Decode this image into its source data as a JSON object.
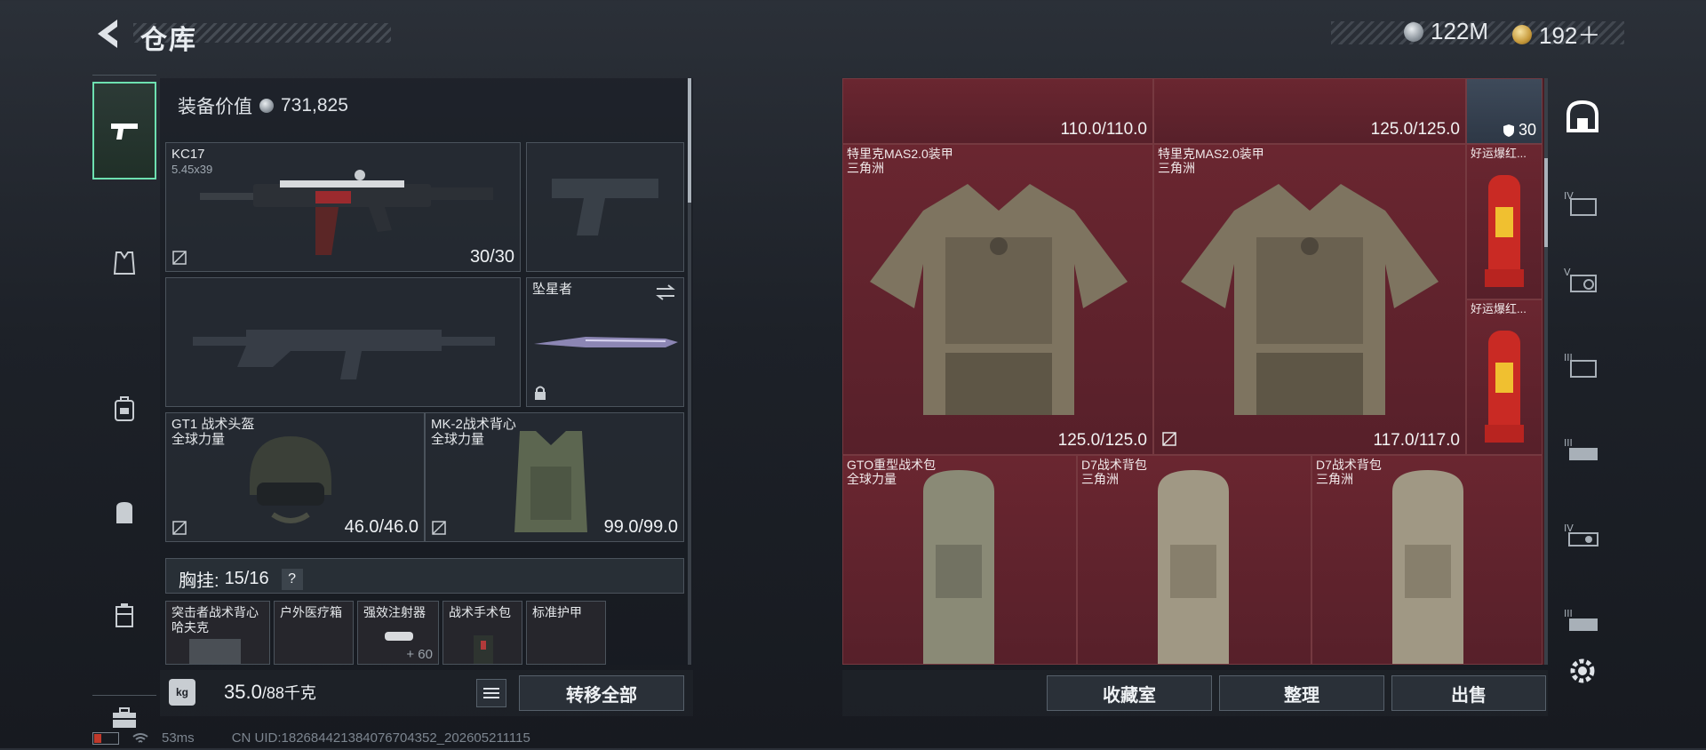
{
  "header": {
    "title": "仓库",
    "currency": [
      {
        "icon": "silver-coin-icon",
        "value": "122M"
      },
      {
        "icon": "gold-coin-icon",
        "value": "192＋"
      }
    ]
  },
  "left_sidebar": {
    "items": [
      {
        "icon": "pistol-icon",
        "active": true
      },
      {
        "icon": "vest-icon",
        "active": false
      },
      {
        "icon": "backpack-alt-icon",
        "active": false
      },
      {
        "icon": "backpack-icon",
        "active": false
      },
      {
        "icon": "case-icon",
        "active": false
      },
      {
        "icon": "briefcase-icon",
        "active": false
      }
    ]
  },
  "equipment": {
    "value_label": "装备价值",
    "value": "731,825",
    "primary_weapon": {
      "name": "KC17",
      "caliber": "5.45x39",
      "ammo": "30/30"
    },
    "melee": {
      "name": "坠星者"
    },
    "helmet": {
      "name": "GT1 战术头盔",
      "brand": "全球力量",
      "durability": "46.0/46.0"
    },
    "armor": {
      "name": "MK-2战术背心",
      "brand": "全球力量",
      "durability": "99.0/99.0"
    },
    "chest_rig": {
      "label": "胸挂:",
      "count": "15/16",
      "help": "?"
    },
    "rig_items": [
      {
        "name": "突击者战术背心 哈夫克"
      },
      {
        "name": "户外医疗箱"
      },
      {
        "name": "强效注射器",
        "count": "+ 60"
      },
      {
        "name": "战术手术包"
      },
      {
        "name": "标准护甲"
      }
    ]
  },
  "bottom_left": {
    "weight": "35.0",
    "capacity": "/88千克",
    "transfer_all_label": "转移全部"
  },
  "stash": {
    "items": [
      {
        "name": "",
        "durability": "110.0/110.0"
      },
      {
        "name": "",
        "durability": "125.0/125.0"
      },
      {
        "name": "",
        "armor_level": "30"
      },
      {
        "name": "特里克MAS2.0装甲",
        "brand": "三角洲",
        "durability": "125.0/125.0"
      },
      {
        "name": "特里克MAS2.0装甲",
        "brand": "三角洲",
        "durability": "117.0/117.0"
      },
      {
        "name": "好运爆红..."
      },
      {
        "name": "好运爆红..."
      },
      {
        "name": "GTO重型战术包",
        "brand": "全球力量"
      },
      {
        "name": "D7战术背包",
        "brand": "三角洲"
      },
      {
        "name": "D7战术背包",
        "brand": "三角洲"
      }
    ],
    "buttons": {
      "collection": "收藏室",
      "organize": "整理",
      "sell": "出售"
    }
  },
  "right_sidebar": {
    "items": [
      {
        "icon": "home-base-icon"
      },
      {
        "icon": "tier-iv-armor-icon"
      },
      {
        "icon": "tier-v-armor-icon"
      },
      {
        "icon": "tier-iii-armor-icon"
      },
      {
        "icon": "tier-iii-rig-icon"
      },
      {
        "icon": "tier-iv-rig-icon"
      },
      {
        "icon": "tier-iii-rig-alt-icon"
      },
      {
        "icon": "settings-gear-icon"
      }
    ]
  },
  "status_bar": {
    "ping": "53ms",
    "uid": "CN UID:18268442138407670435​2_202605211115"
  },
  "colors": {
    "accent": "#6de0b0",
    "stash_bg": "#5a2029",
    "panel_border": "#4b535c"
  }
}
